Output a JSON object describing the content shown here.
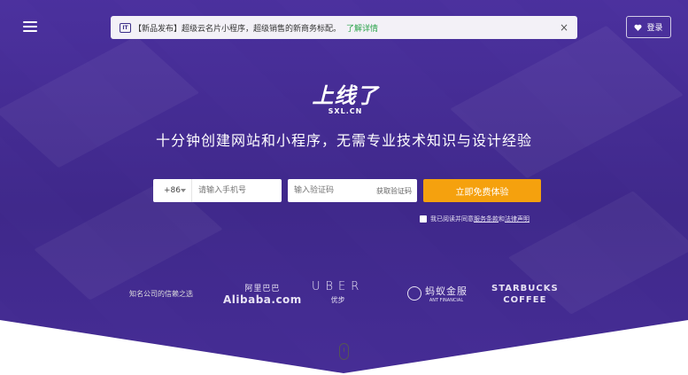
{
  "notice": {
    "badge": "IT",
    "text": "【新品发布】超级云名片小程序，超级销售的新商务标配。",
    "link": "了解详情",
    "close": "×"
  },
  "header": {
    "login_icon": "heart-icon",
    "login_label": "登录"
  },
  "logo": {
    "main": "上线了",
    "sub": "SXL.CN"
  },
  "tagline": "十分钟创建网站和小程序，无需专业技术知识与设计经验",
  "form": {
    "country_code": "+86",
    "phone_placeholder": "请输入手机号",
    "code_placeholder": "输入验证码",
    "get_code": "获取验证码",
    "cta": "立即免费体验"
  },
  "agreement": {
    "prefix": "我已阅读并同意",
    "terms": "服务条款",
    "and": "和",
    "legal": "法律声明"
  },
  "trust": {
    "label": "知名公司的信赖之选",
    "alibaba_cn": "阿里巴巴",
    "alibaba_en": "Alibaba.com",
    "uber_en": "UBER",
    "uber_cn": "优步",
    "ant_cn": "蚂蚁金服",
    "ant_en": "ANT FINANCIAL",
    "starbucks_1": "STARBUCKS",
    "starbucks_2": "COFFEE"
  },
  "colors": {
    "accent": "#f5a10e",
    "background": "#3f2a86",
    "link_green": "#2aa34a"
  }
}
